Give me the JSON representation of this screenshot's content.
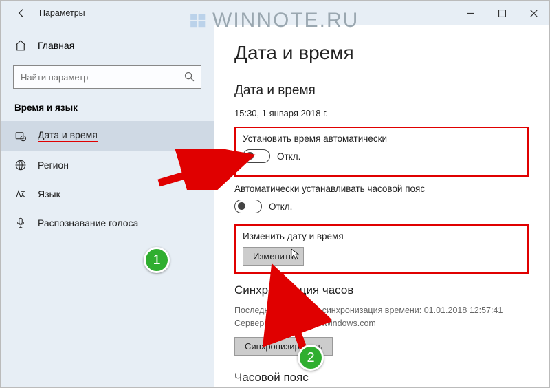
{
  "titlebar": {
    "title": "Параметры"
  },
  "sidebar": {
    "home": "Главная",
    "search_placeholder": "Найти параметр",
    "category": "Время и язык",
    "items": [
      {
        "label": "Дата и время",
        "selected": true
      },
      {
        "label": "Регион"
      },
      {
        "label": "Язык"
      },
      {
        "label": "Распознавание голоса"
      }
    ]
  },
  "main": {
    "h1": "Дата и время",
    "h2": "Дата и время",
    "datetime": "15:30, 1 января 2018 г.",
    "auto_time_label": "Установить время автоматически",
    "auto_time_state": "Откл.",
    "auto_tz_label": "Автоматически устанавливать часовой пояс",
    "auto_tz_state": "Откл.",
    "change_dt_label": "Изменить дату и время",
    "change_btn": "Изменить",
    "sync_head": "Синхронизация часов",
    "sync_line1": "Последняя успешная синхронизация времени:  01.01.2018  12:57:41",
    "sync_line2": "Сервер времени: time.windows.com",
    "sync_btn": "Синхронизировать",
    "tz_head": "Часовой пояс"
  },
  "watermark": "WINNOTE.RU",
  "badges": {
    "one": "1",
    "two": "2"
  }
}
